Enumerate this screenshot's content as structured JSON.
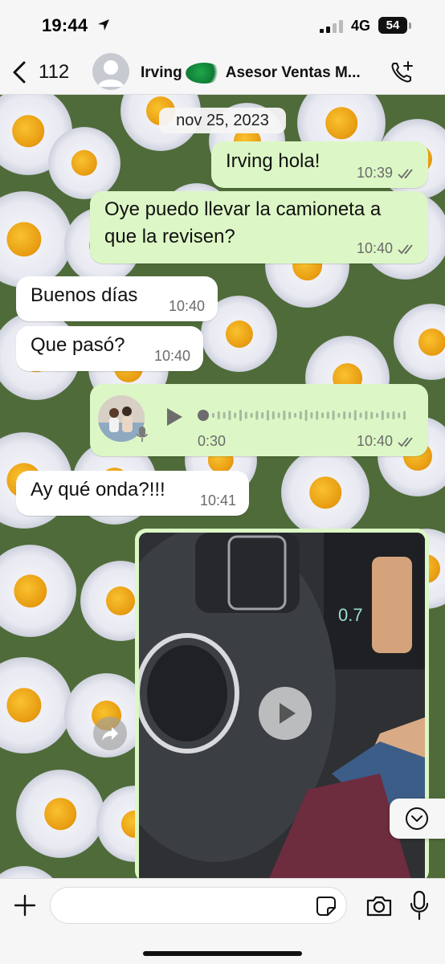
{
  "status_bar": {
    "time": "19:44",
    "network": "4G",
    "battery": "54"
  },
  "header": {
    "back_count": "112",
    "contact_name_first": "Irving",
    "contact_name_rest": "Asesor Ventas M..."
  },
  "date_chip": "nov 25, 2023",
  "messages": [
    {
      "direction": "out",
      "text": "Irving hola!",
      "time": "10:39",
      "status": "read"
    },
    {
      "direction": "out",
      "text_line1": "Oye puedo llevar la camioneta a",
      "text_line2": "que la revisen?",
      "time": "10:40",
      "status": "read"
    },
    {
      "direction": "in",
      "text": "Buenos días",
      "time": "10:40"
    },
    {
      "direction": "in",
      "text": "Que pasó?",
      "time": "10:40"
    },
    {
      "direction": "out",
      "type": "voice",
      "duration": "0:30",
      "time": "10:40",
      "status": "read"
    },
    {
      "direction": "in",
      "text": "Ay qué onda?!!!",
      "time": "10:41"
    },
    {
      "direction": "out",
      "type": "video"
    }
  ],
  "input": {
    "value": "",
    "placeholder": ""
  },
  "colors": {
    "outgoing_bubble": "#dcf7c5",
    "incoming_bubble": "#ffffff",
    "tick_color": "#6b6b6b"
  },
  "icons": [
    "back-chevron-icon",
    "avatar-placeholder-icon",
    "add-call-icon",
    "play-icon",
    "mic-icon",
    "forward-icon",
    "chevron-down-icon",
    "plus-icon",
    "sticker-icon",
    "camera-icon",
    "microphone-icon"
  ]
}
